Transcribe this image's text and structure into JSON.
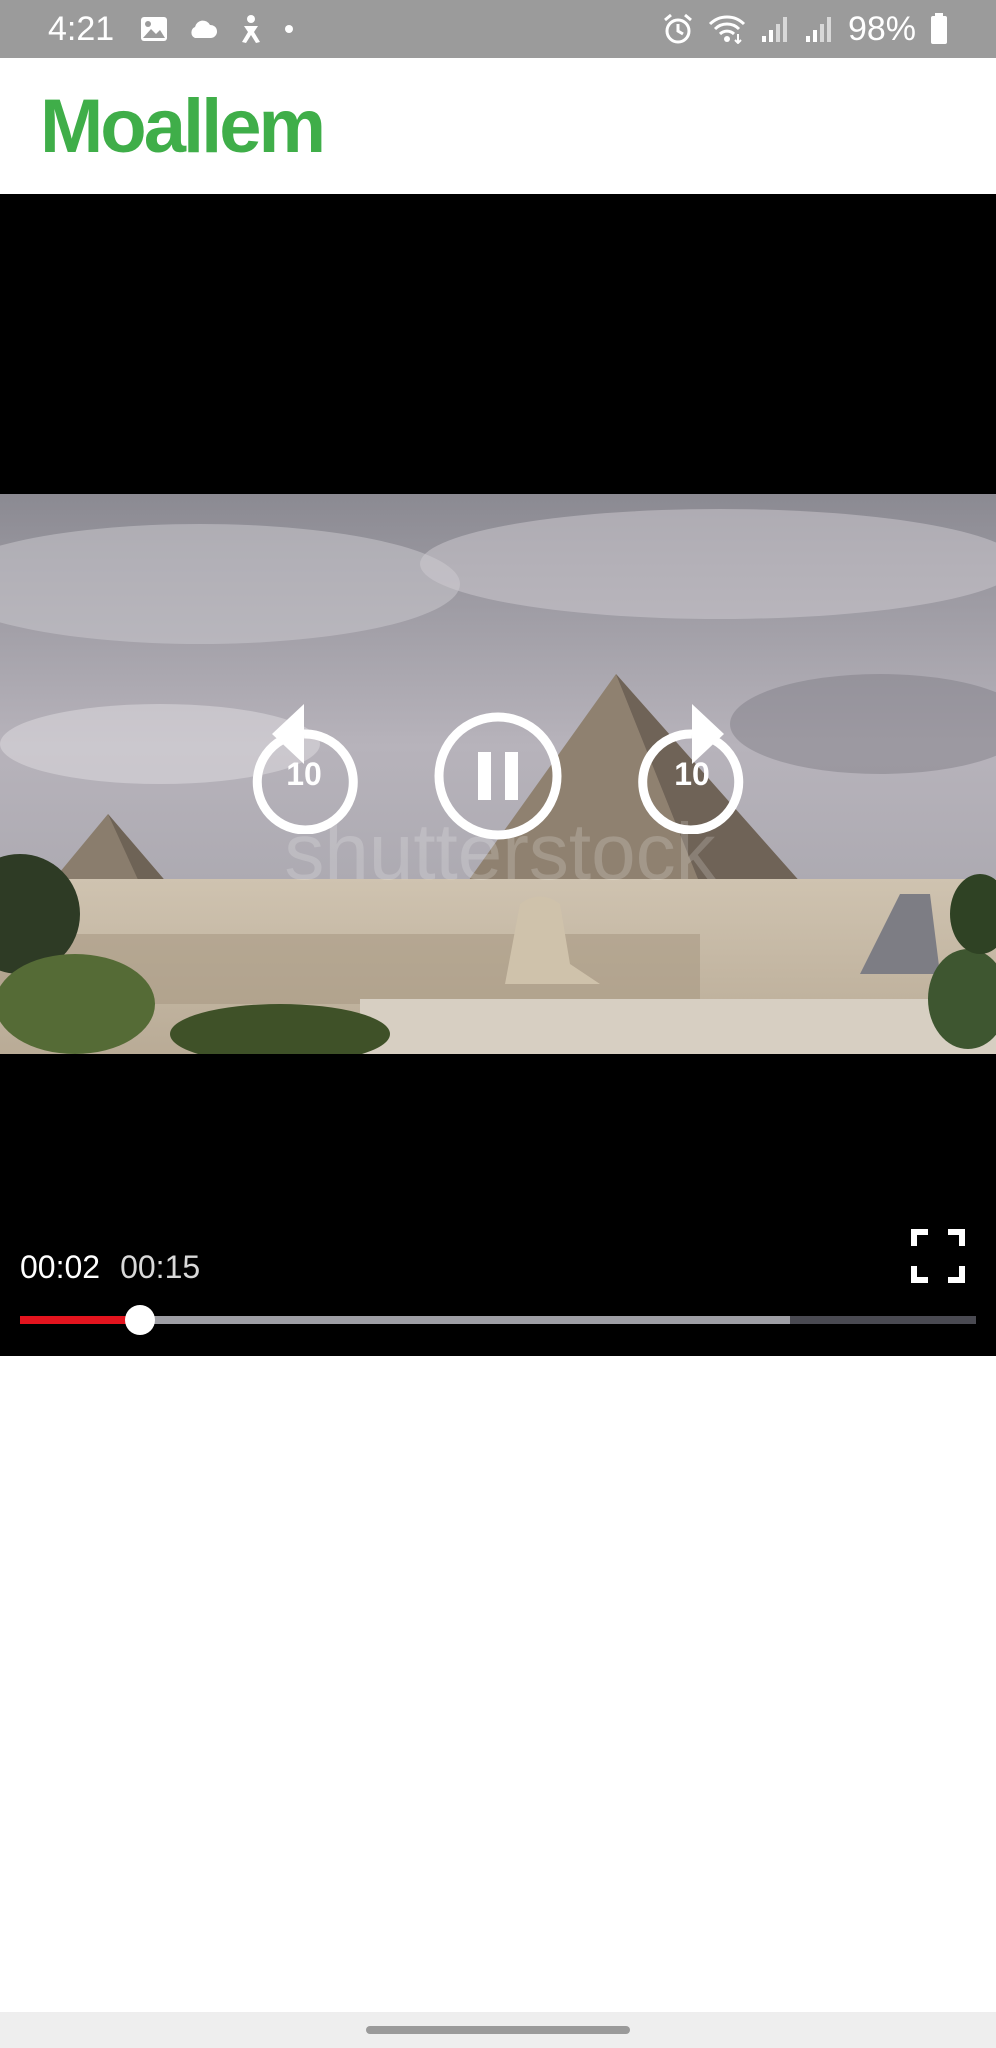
{
  "status_bar": {
    "time": "4:21",
    "left_icons": [
      "image-icon",
      "cloud-icon",
      "accessibility-icon",
      "dot-icon"
    ],
    "right_icons": [
      "alarm-icon",
      "wifi-icon",
      "signal-icon",
      "signal-icon",
      "battery-icon"
    ],
    "battery": "98%"
  },
  "header": {
    "logo": "Moallem",
    "brand_color": "#3fae49"
  },
  "player": {
    "watermark": "shutterstock",
    "rewind_label": "10",
    "forward_label": "10",
    "state": "playing",
    "current_time": "00:02",
    "duration": "00:15",
    "progress_fraction": 0.125,
    "buffered_fraction": 0.805,
    "progress_color": "#e3141e",
    "icons": {
      "rewind": "replay-10-icon",
      "pause": "pause-icon",
      "forward": "forward-10-icon",
      "fullscreen": "fullscreen-icon"
    }
  }
}
